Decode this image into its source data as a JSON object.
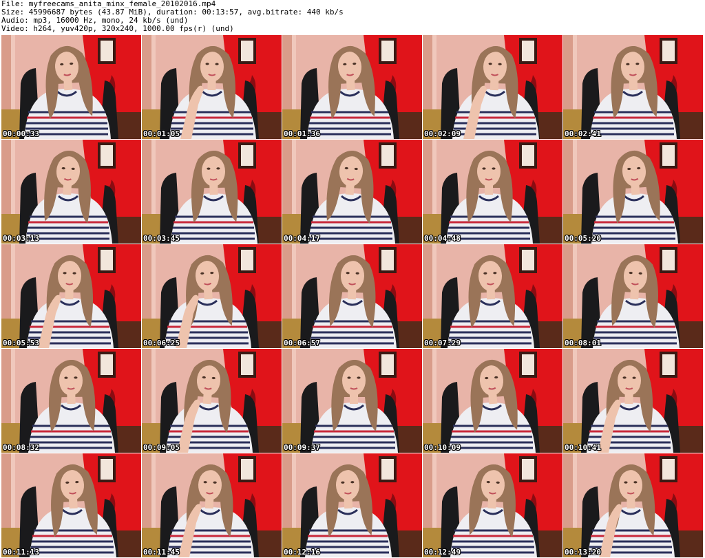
{
  "header": {
    "file_line": "File: myfreecams_anita_minx_female_20102016.mp4",
    "size_line": "Size: 45996687 bytes (43.87 MiB), duration: 00:13:57, avg.bitrate: 440 kb/s",
    "audio_line": "Audio: mp3, 16000 Hz, mono, 24 kb/s (und)",
    "video_line": "Video: h264, yuv420p, 320x240, 1000.00 fps(r) (und)"
  },
  "colors": {
    "wall_red": "#e0141a",
    "wall_pink": "#e8b4a8",
    "shirt_white": "#eeeef2",
    "stripe_navy": "#2a2f5a",
    "stripe_red": "#c8283a",
    "hair_brown": "#9a7458",
    "skin": "#eec3ad",
    "chair_black": "#1a1a1c",
    "floor_wood": "#b48a3c",
    "frame_dark": "#3a1a14"
  },
  "thumbnails": [
    {
      "timestamp": "00:00:33"
    },
    {
      "timestamp": "00:01:05"
    },
    {
      "timestamp": "00:01:36"
    },
    {
      "timestamp": "00:02:09"
    },
    {
      "timestamp": "00:02:41"
    },
    {
      "timestamp": "00:03:13"
    },
    {
      "timestamp": "00:03:45"
    },
    {
      "timestamp": "00:04:17"
    },
    {
      "timestamp": "00:04:48"
    },
    {
      "timestamp": "00:05:20"
    },
    {
      "timestamp": "00:05:53"
    },
    {
      "timestamp": "00:06:25"
    },
    {
      "timestamp": "00:06:57"
    },
    {
      "timestamp": "00:07:29"
    },
    {
      "timestamp": "00:08:01"
    },
    {
      "timestamp": "00:08:32"
    },
    {
      "timestamp": "00:09:05"
    },
    {
      "timestamp": "00:09:37"
    },
    {
      "timestamp": "00:10:09"
    },
    {
      "timestamp": "00:10:41"
    },
    {
      "timestamp": "00:11:13"
    },
    {
      "timestamp": "00:11:45"
    },
    {
      "timestamp": "00:12:16"
    },
    {
      "timestamp": "00:12:49"
    },
    {
      "timestamp": "00:13:20"
    }
  ]
}
